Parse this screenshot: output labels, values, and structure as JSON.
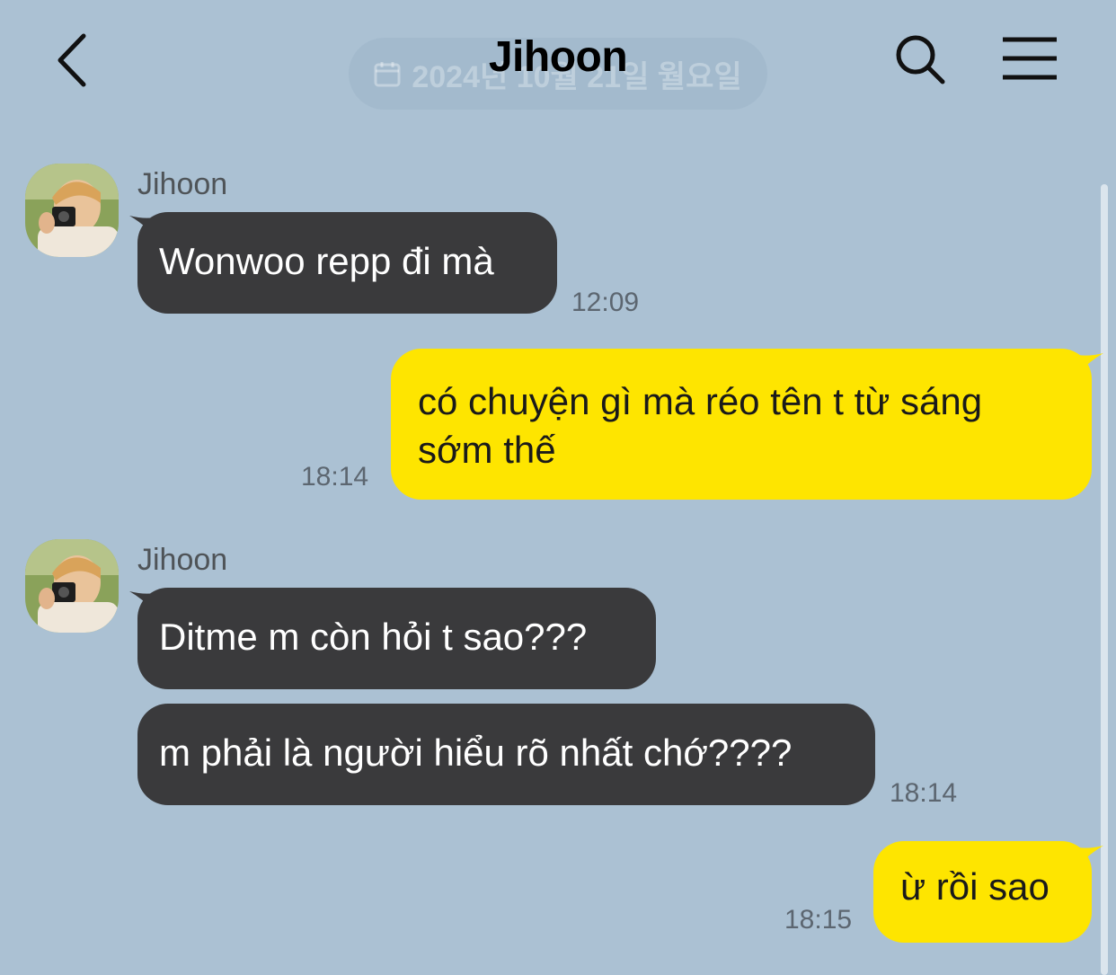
{
  "header": {
    "title": "Jihoon",
    "date_divider": "2024년 10월 21일 월요일",
    "icons": {
      "back": "chevron-left-icon",
      "search": "search-icon",
      "menu": "hamburger-menu-icon"
    }
  },
  "colors": {
    "background": "#abc1d3",
    "incoming_bubble": "#3a3a3c",
    "outgoing_bubble": "#fee500",
    "timestamp": "#5c6670"
  },
  "messages": [
    {
      "sender": "Jihoon",
      "direction": "incoming",
      "text": "Wonwoo repp đi mà",
      "time": "12:09"
    },
    {
      "direction": "outgoing",
      "text": "có chuyện gì mà réo tên t từ sáng sớm thế",
      "time": "18:14"
    },
    {
      "sender": "Jihoon",
      "direction": "incoming",
      "text": "Ditme m còn hỏi t sao???"
    },
    {
      "direction": "incoming",
      "text": "m phải là người hiểu rõ nhất chớ????",
      "time": "18:14"
    },
    {
      "direction": "outgoing",
      "text": "ừ rồi sao",
      "time": "18:15"
    }
  ]
}
